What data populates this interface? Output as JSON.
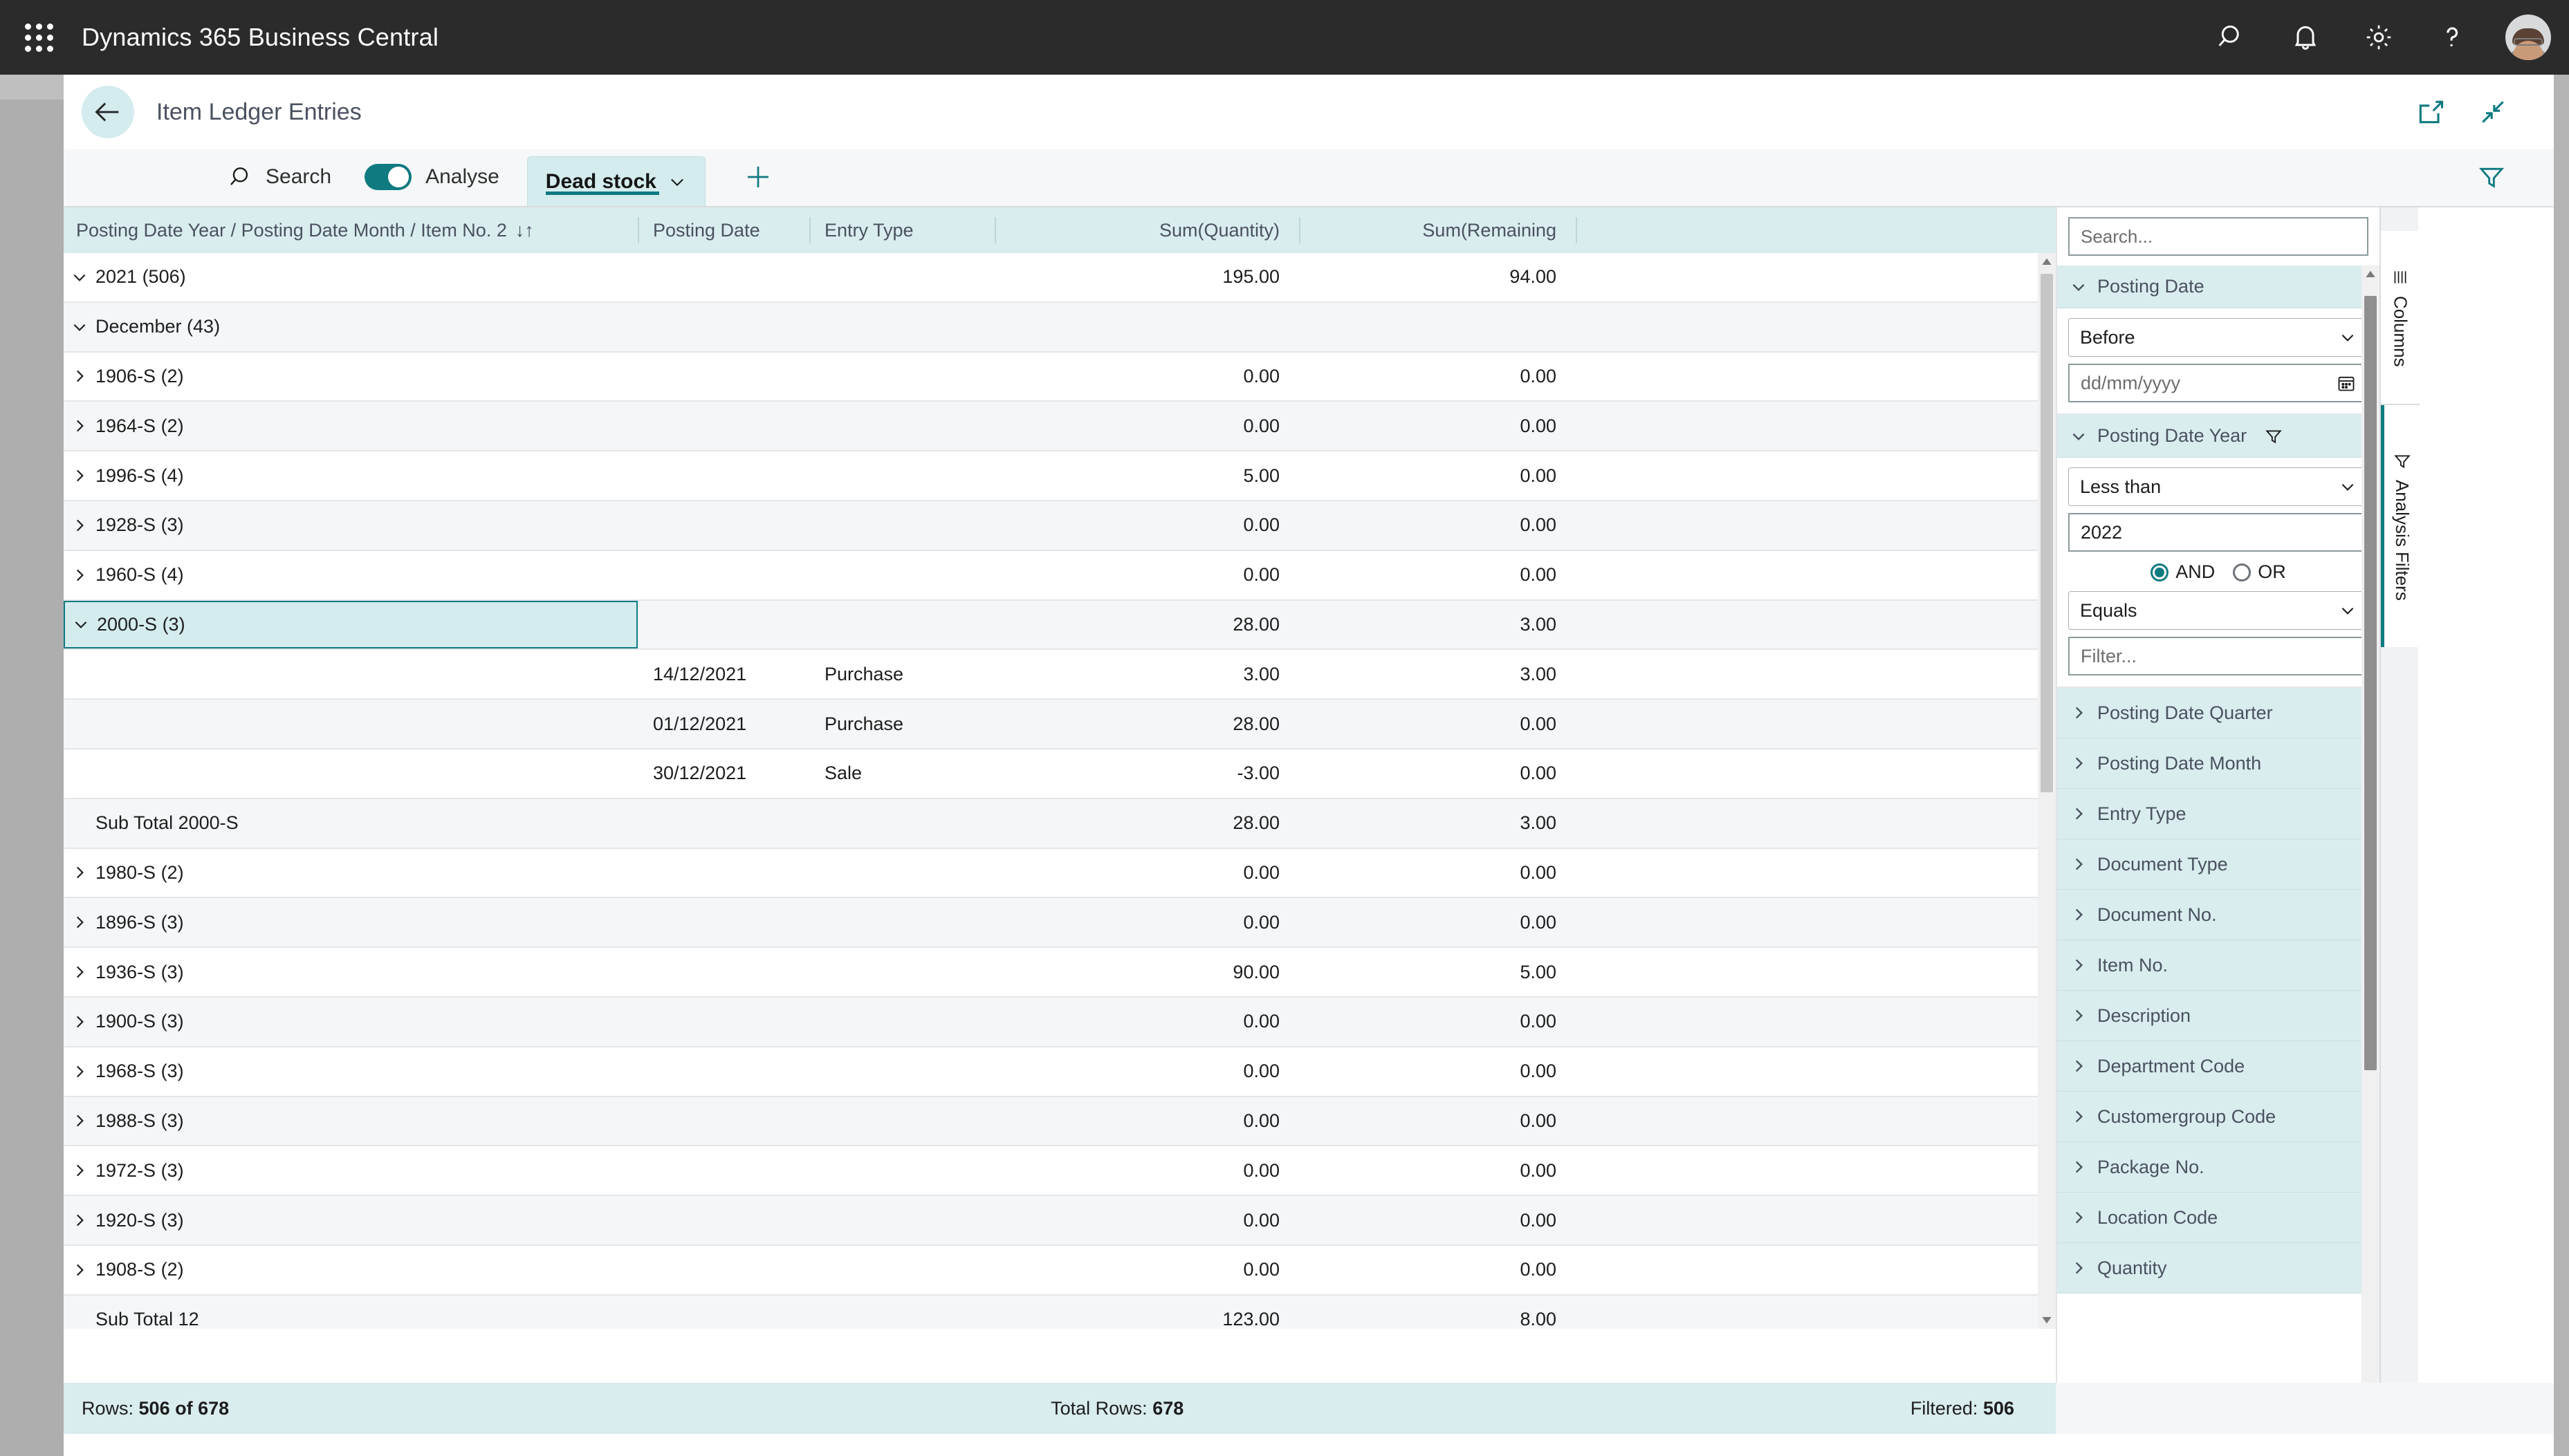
{
  "topbar": {
    "app_title": "Dynamics 365 Business Central",
    "icons": {
      "waffle": "app-launcher-icon",
      "search": "search-icon",
      "notifications": "bell-icon",
      "settings": "gear-icon",
      "help": "question-mark-icon",
      "account": "user-avatar"
    }
  },
  "page_header": {
    "back_label": "back-arrow",
    "title": "Item Ledger Entries",
    "open_in_new_label": "open-in-new-window",
    "collapse_label": "collapse-view"
  },
  "toolbar": {
    "search_label": "Search",
    "analyse_label": "Analyse",
    "analyse_on": true,
    "tab_label": "Dead stock",
    "add_tab_label": "+",
    "filter_label": "filter"
  },
  "grid": {
    "columns": [
      "Posting Date Year / Posting Date Month / Item No. 2",
      "Posting Date",
      "Entry Type",
      "Sum(Quantity)",
      "Sum(Remaining"
    ],
    "sort_indicator": "↓↑",
    "rows": [
      {
        "level": 0,
        "chev": "down",
        "label": "2021 (506)",
        "date": "",
        "entry": "",
        "qty": "195.00",
        "rem": "94.00",
        "alt": false,
        "selected": false
      },
      {
        "level": 1,
        "chev": "down",
        "label": "December (43)",
        "date": "",
        "entry": "",
        "qty": "",
        "rem": "",
        "alt": true,
        "selected": false
      },
      {
        "level": 2,
        "chev": "right",
        "label": "1906-S (2)",
        "date": "",
        "entry": "",
        "qty": "0.00",
        "rem": "0.00",
        "alt": false,
        "selected": false
      },
      {
        "level": 2,
        "chev": "right",
        "label": "1964-S (2)",
        "date": "",
        "entry": "",
        "qty": "0.00",
        "rem": "0.00",
        "alt": true,
        "selected": false
      },
      {
        "level": 2,
        "chev": "right",
        "label": "1996-S (4)",
        "date": "",
        "entry": "",
        "qty": "5.00",
        "rem": "0.00",
        "alt": false,
        "selected": false
      },
      {
        "level": 2,
        "chev": "right",
        "label": "1928-S (3)",
        "date": "",
        "entry": "",
        "qty": "0.00",
        "rem": "0.00",
        "alt": true,
        "selected": false
      },
      {
        "level": 2,
        "chev": "right",
        "label": "1960-S (4)",
        "date": "",
        "entry": "",
        "qty": "0.00",
        "rem": "0.00",
        "alt": false,
        "selected": false
      },
      {
        "level": 2,
        "chev": "down",
        "label": "2000-S (3)",
        "date": "",
        "entry": "",
        "qty": "28.00",
        "rem": "3.00",
        "alt": true,
        "selected": true
      },
      {
        "level": 3,
        "chev": "none",
        "label": "",
        "date": "14/12/2021",
        "entry": "Purchase",
        "qty": "3.00",
        "rem": "3.00",
        "alt": false,
        "selected": false
      },
      {
        "level": 3,
        "chev": "none",
        "label": "",
        "date": "01/12/2021",
        "entry": "Purchase",
        "qty": "28.00",
        "rem": "0.00",
        "alt": true,
        "selected": false
      },
      {
        "level": 3,
        "chev": "none",
        "label": "",
        "date": "30/12/2021",
        "entry": "Sale",
        "qty": "-3.00",
        "rem": "0.00",
        "alt": false,
        "selected": false
      },
      {
        "level": "sub",
        "chev": "none",
        "label": "Sub Total 2000-S",
        "date": "",
        "entry": "",
        "qty": "28.00",
        "rem": "3.00",
        "alt": true,
        "selected": false
      },
      {
        "level": 2,
        "chev": "right",
        "label": "1980-S (2)",
        "date": "",
        "entry": "",
        "qty": "0.00",
        "rem": "0.00",
        "alt": false,
        "selected": false
      },
      {
        "level": 2,
        "chev": "right",
        "label": "1896-S (3)",
        "date": "",
        "entry": "",
        "qty": "0.00",
        "rem": "0.00",
        "alt": true,
        "selected": false
      },
      {
        "level": 2,
        "chev": "right",
        "label": "1936-S (3)",
        "date": "",
        "entry": "",
        "qty": "90.00",
        "rem": "5.00",
        "alt": false,
        "selected": false
      },
      {
        "level": 2,
        "chev": "right",
        "label": "1900-S (3)",
        "date": "",
        "entry": "",
        "qty": "0.00",
        "rem": "0.00",
        "alt": true,
        "selected": false
      },
      {
        "level": 2,
        "chev": "right",
        "label": "1968-S (3)",
        "date": "",
        "entry": "",
        "qty": "0.00",
        "rem": "0.00",
        "alt": false,
        "selected": false
      },
      {
        "level": 2,
        "chev": "right",
        "label": "1988-S (3)",
        "date": "",
        "entry": "",
        "qty": "0.00",
        "rem": "0.00",
        "alt": true,
        "selected": false
      },
      {
        "level": 2,
        "chev": "right",
        "label": "1972-S (3)",
        "date": "",
        "entry": "",
        "qty": "0.00",
        "rem": "0.00",
        "alt": false,
        "selected": false
      },
      {
        "level": 2,
        "chev": "right",
        "label": "1920-S (3)",
        "date": "",
        "entry": "",
        "qty": "0.00",
        "rem": "0.00",
        "alt": true,
        "selected": false
      },
      {
        "level": 2,
        "chev": "right",
        "label": "1908-S (2)",
        "date": "",
        "entry": "",
        "qty": "0.00",
        "rem": "0.00",
        "alt": false,
        "selected": false
      },
      {
        "level": "sub",
        "chev": "none",
        "label": "Sub Total 12",
        "date": "",
        "entry": "",
        "qty": "123.00",
        "rem": "8.00",
        "alt": true,
        "selected": false
      }
    ]
  },
  "filter_pane": {
    "search_placeholder": "Search...",
    "posting_date": {
      "title": "Posting Date",
      "operator": "Before",
      "date_placeholder": "dd/mm/yyyy"
    },
    "posting_date_year": {
      "title": "Posting Date Year",
      "has_filter_icon": true,
      "operator": "Less than",
      "value": "2022",
      "conjunction_and": "AND",
      "conjunction_or": "OR",
      "conjunction_selected": "AND",
      "operator2": "Equals",
      "filter_placeholder": "Filter..."
    },
    "collapsed_items": [
      "Posting Date Quarter",
      "Posting Date Month",
      "Entry Type",
      "Document Type",
      "Document No.",
      "Item No.",
      "Description",
      "Department Code",
      "Customergroup Code",
      "Package No.",
      "Location Code",
      "Quantity"
    ]
  },
  "vertical_tabs": [
    {
      "label": "Columns",
      "icon": "columns-icon",
      "active": false
    },
    {
      "label": "Analysis Filters",
      "icon": "funnel-icon",
      "active": true
    }
  ],
  "statusbar": {
    "rows_prefix": "Rows: ",
    "rows_value": "506 of 678",
    "total_prefix": "Total Rows: ",
    "total_value": "678",
    "filtered_prefix": "Filtered: ",
    "filtered_value": "506"
  },
  "colors": {
    "accent": "#0f7a80",
    "accent_light": "#d4ecee",
    "topbar": "#2b2b2b",
    "title_text": "#4a5160"
  }
}
